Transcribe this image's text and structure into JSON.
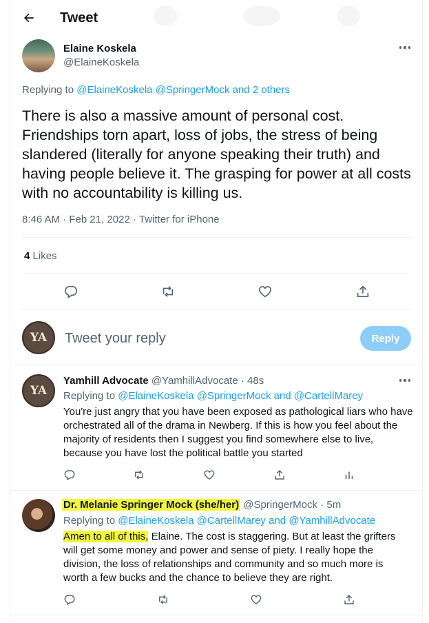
{
  "header": {
    "title": "Tweet"
  },
  "main_tweet": {
    "name": "Elaine Koskela",
    "handle": "@ElaineKoskela",
    "replying_prefix": "Replying to",
    "replying_to": [
      "@ElaineKoskela",
      "@SpringerMock",
      "and 2 others"
    ],
    "text": "There is also a massive amount of personal cost. Friendships torn apart, loss of jobs, the stress of being slandered (literally for anyone speaking their truth) and having people believe it. The grasping for power at all costs with no accountability is killing us.",
    "time": "8:46 AM",
    "date": "Feb 21, 2022",
    "source": "Twitter for iPhone",
    "likes_count": "4",
    "likes_label": "Likes"
  },
  "compose": {
    "avatar_text": "YA",
    "placeholder": "Tweet your reply",
    "button": "Reply"
  },
  "replies": [
    {
      "name": "Yamhill Advocate",
      "handle": "@YamhillAdvocate",
      "time": "· 48s",
      "avatar_text": "YA",
      "replying_prefix": "Replying to",
      "replying_to_1": "@ElaineKoskela",
      "replying_to_2": "@SpringerMock",
      "replying_and": "and",
      "replying_to_3": "@CartellMarey",
      "line1": "You're just angry that you have been exposed as pathological liars who have",
      "line2": "orchestrated all of the drama in Newberg. If this is how you feel about the",
      "line3": "majority of residents then I suggest you find somewhere else to live,",
      "line4": "because you have lost the political battle you started"
    },
    {
      "name": "Dr. Melanie Springer Mock (she/her)",
      "handle": "@SpringerMock",
      "time": "· 5m",
      "replying_prefix": "Replying to",
      "replying_to_1": "@ElaineKoskela",
      "replying_to_2": "@CartellMarey",
      "replying_and": "and",
      "replying_to_3": "@YamhillAdvocate",
      "line1_highlight": "Amen to all of this,",
      "line1_rest": " Elaine. The cost is staggering. But at least the grifters",
      "line2": "will get some money and power and sense of piety. I really hope the",
      "line3": "division, the loss of relationships and community and so much more is",
      "line4": "worth a few bucks and the chance to believe they are right."
    }
  ],
  "colors": {
    "accent": "#1d9bf0",
    "highlight": "#f3f73a",
    "muted": "#536471"
  },
  "icons": [
    "back-arrow-icon",
    "more-icon",
    "reply-icon",
    "retweet-icon",
    "like-icon",
    "share-icon",
    "analytics-icon"
  ]
}
